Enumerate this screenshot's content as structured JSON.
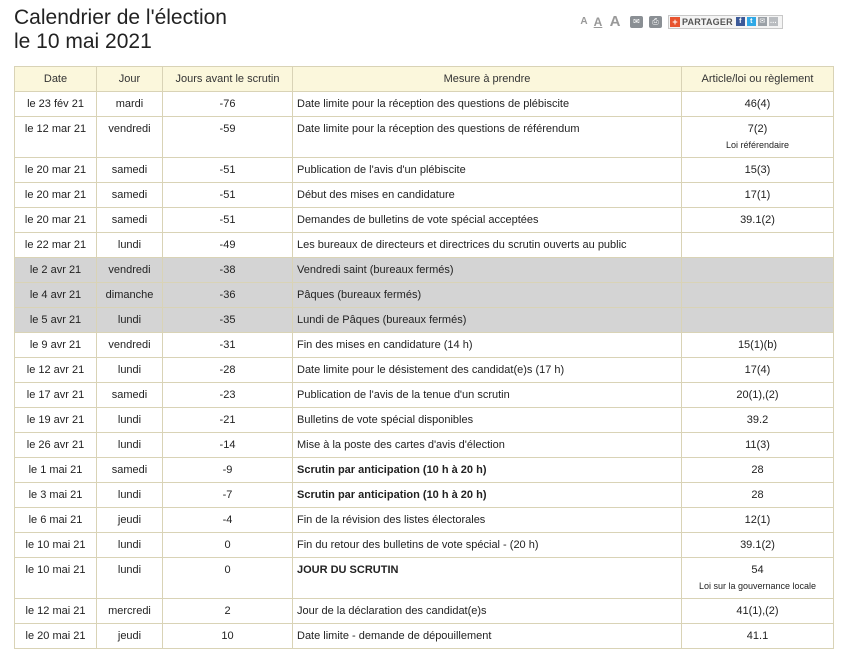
{
  "page": {
    "title_line1": "Calendrier de l'élection",
    "title_line2": "le 10 mai 2021"
  },
  "toolbar": {
    "font_small": "A",
    "font_medium": "A",
    "font_large": "A",
    "share_label": "PARTAGER"
  },
  "table": {
    "headers": {
      "date": "Date",
      "day": "Jour",
      "days_before": "Jours avant le scrutin",
      "measure": "Mesure à prendre",
      "article": "Article/loi ou règlement"
    },
    "rows": [
      {
        "date": "le 23 fév 21",
        "day": "mardi",
        "days": "-76",
        "measure": "Date limite pour la réception des questions de plébiscite",
        "article": "46(4)",
        "note": ""
      },
      {
        "date": "le 12 mar 21",
        "day": "vendredi",
        "days": "-59",
        "measure": "Date limite pour la réception des questions de référendum",
        "article": "7(2)",
        "note": "Loi référendaire"
      },
      {
        "date": "le 20 mar 21",
        "day": "samedi",
        "days": "-51",
        "measure": "Publication de l'avis d'un plébiscite",
        "article": "15(3)",
        "note": ""
      },
      {
        "date": "le 20 mar 21",
        "day": "samedi",
        "days": "-51",
        "measure": "Début des mises en candidature",
        "article": "17(1)",
        "note": ""
      },
      {
        "date": "le 20 mar 21",
        "day": "samedi",
        "days": "-51",
        "measure": "Demandes de bulletins de vote spécial acceptées",
        "article": "39.1(2)",
        "note": ""
      },
      {
        "date": "le 22 mar 21",
        "day": "lundi",
        "days": "-49",
        "measure": "Les bureaux de directeurs et directrices du scrutin ouverts au public",
        "article": "",
        "note": ""
      },
      {
        "date": "le 2 avr 21",
        "day": "vendredi",
        "days": "-38",
        "measure": "Vendredi saint (bureaux fermés)",
        "article": "",
        "note": "",
        "holiday": true
      },
      {
        "date": "le 4 avr 21",
        "day": "dimanche",
        "days": "-36",
        "measure": "Pâques (bureaux fermés)",
        "article": "",
        "note": "",
        "holiday": true
      },
      {
        "date": "le 5 avr 21",
        "day": "lundi",
        "days": "-35",
        "measure": "Lundi de Pâques (bureaux fermés)",
        "article": "",
        "note": "",
        "holiday": true
      },
      {
        "date": "le 9 avr 21",
        "day": "vendredi",
        "days": "-31",
        "measure": "Fin des mises en candidature (14 h)",
        "article": "15(1)(b)",
        "note": ""
      },
      {
        "date": "le 12 avr 21",
        "day": "lundi",
        "days": "-28",
        "measure": "Date limite pour le désistement des candidat(e)s (17 h)",
        "article": "17(4)",
        "note": ""
      },
      {
        "date": "le 17 avr 21",
        "day": "samedi",
        "days": "-23",
        "measure": "Publication de l'avis de la tenue d'un scrutin",
        "article": "20(1),(2)",
        "note": ""
      },
      {
        "date": "le 19 avr 21",
        "day": "lundi",
        "days": "-21",
        "measure": "Bulletins de vote spécial disponibles",
        "article": "39.2",
        "note": ""
      },
      {
        "date": "le 26 avr 21",
        "day": "lundi",
        "days": "-14",
        "measure": "Mise à la poste des cartes d'avis d'élection",
        "article": "11(3)",
        "note": ""
      },
      {
        "date": "le 1 mai 21",
        "day": "samedi",
        "days": "-9",
        "measure": "Scrutin par anticipation (10 h à 20 h)",
        "article": "28",
        "note": "",
        "bold": true
      },
      {
        "date": "le 3 mai 21",
        "day": "lundi",
        "days": "-7",
        "measure": "Scrutin par anticipation (10 h à 20 h)",
        "article": "28",
        "note": "",
        "bold": true
      },
      {
        "date": "le 6 mai 21",
        "day": "jeudi",
        "days": "-4",
        "measure": "Fin de la révision des listes électorales",
        "article": "12(1)",
        "note": ""
      },
      {
        "date": "le 10 mai 21",
        "day": "lundi",
        "days": "0",
        "measure": "Fin du retour des bulletins de vote spécial - (20 h)",
        "article": "39.1(2)",
        "note": ""
      },
      {
        "date": "le 10 mai 21",
        "day": "lundi",
        "days": "0",
        "measure": "JOUR DU SCRUTIN",
        "article": "54",
        "note": "Loi sur la gouvernance locale",
        "bold": true
      },
      {
        "date": "le 12 mai 21",
        "day": "mercredi",
        "days": "2",
        "measure": "Jour de la déclaration des candidat(e)s",
        "article": "41(1),(2)",
        "note": ""
      },
      {
        "date": "le 20 mai 21",
        "day": "jeudi",
        "days": "10",
        "measure": "Date limite - demande de dépouillement",
        "article": "41.1",
        "note": ""
      }
    ]
  }
}
